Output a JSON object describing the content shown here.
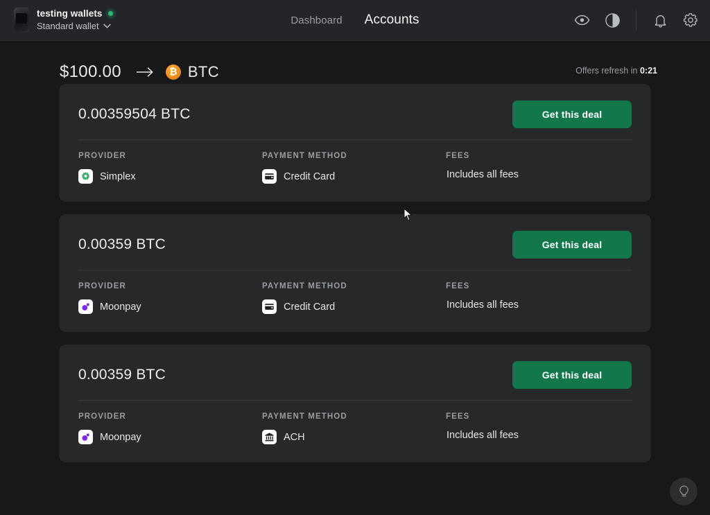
{
  "header": {
    "wallet_name": "testing wallets",
    "wallet_type": "Standard wallet",
    "status_dot_color": "#2bb673",
    "nav": [
      {
        "label": "Dashboard",
        "active": false
      },
      {
        "label": "Accounts",
        "active": true
      }
    ],
    "icons": [
      {
        "name": "eye-icon"
      },
      {
        "name": "contrast-icon"
      },
      {
        "name": "bell-icon"
      },
      {
        "name": "gear-icon"
      }
    ]
  },
  "summary": {
    "fiat_amount": "$100.00",
    "arrow": "→",
    "crypto_symbol": "₿",
    "crypto_label": "BTC",
    "refresh_prefix": "Offers refresh in",
    "refresh_timer": "0:21",
    "btc_color": "#f08f1b"
  },
  "labels": {
    "provider": "PROVIDER",
    "payment_method": "PAYMENT METHOD",
    "fees": "FEES",
    "deal_button": "Get this deal"
  },
  "offers": [
    {
      "amount": "0.00359504 BTC",
      "button": "Get this deal",
      "provider": "Simplex",
      "provider_icon": "simplex-icon",
      "payment_method": "Credit Card",
      "payment_icon": "credit-card-icon",
      "fees": "Includes all fees"
    },
    {
      "amount": "0.00359 BTC",
      "button": "Get this deal",
      "provider": "Moonpay",
      "provider_icon": "moonpay-icon",
      "payment_method": "Credit Card",
      "payment_icon": "credit-card-icon",
      "fees": "Includes all fees"
    },
    {
      "amount": "0.00359 BTC",
      "button": "Get this deal",
      "provider": "Moonpay",
      "provider_icon": "moonpay-icon",
      "payment_method": "ACH",
      "payment_icon": "bank-icon",
      "fees": "Includes all fees"
    }
  ],
  "fab": {
    "name": "help-lightbulb-button"
  },
  "colors": {
    "page_bg": "#17181a",
    "header_bg": "#232529",
    "card_bg": "#26282a",
    "accent_green": "#12774a",
    "moonpay_purple": "#7d2ae8"
  }
}
